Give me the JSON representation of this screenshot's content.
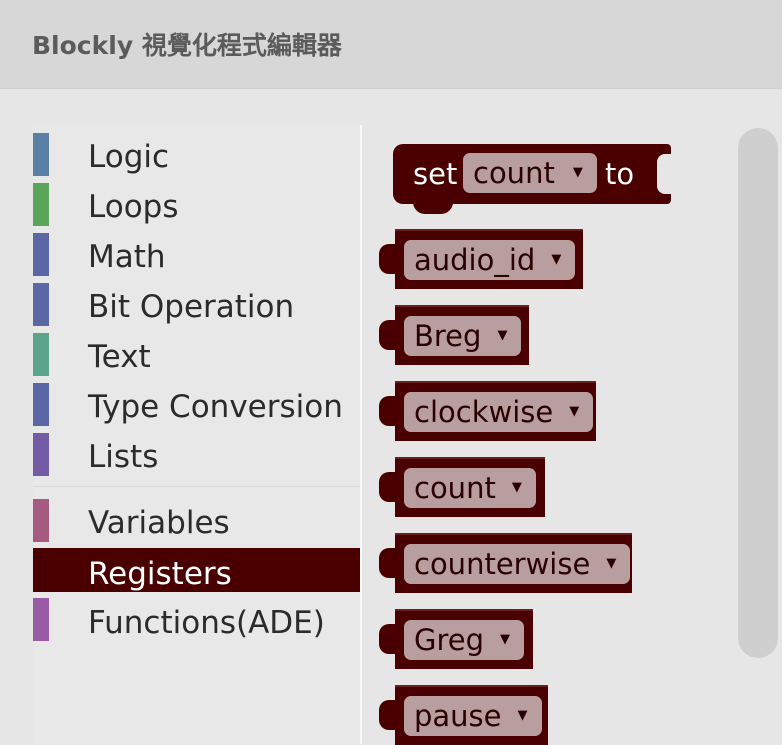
{
  "header": {
    "title": "Blockly 視覺化程式編輯器"
  },
  "toolbox": {
    "categories": [
      {
        "label": "Logic",
        "color": "#5b80a5"
      },
      {
        "label": "Loops",
        "color": "#5ba55b"
      },
      {
        "label": "Math",
        "color": "#5b67a5"
      },
      {
        "label": "Bit Operation",
        "color": "#5b67a5"
      },
      {
        "label": "Text",
        "color": "#5ba58c"
      },
      {
        "label": "Type Conversion",
        "color": "#5b67a5"
      },
      {
        "label": "Lists",
        "color": "#745ba5"
      },
      {
        "label": "Variables",
        "color": "#a55b80"
      },
      {
        "label": "Registers",
        "color": "#4a0000",
        "selected": true
      },
      {
        "label": "Functions(ADE)",
        "color": "#995ba5"
      }
    ]
  },
  "flyout": {
    "set_block": {
      "set_label": "set",
      "var": "count",
      "to_label": "to"
    },
    "getters": [
      "audio_id",
      "Breg",
      "clockwise",
      "count",
      "counterwise",
      "Greg",
      "pause"
    ],
    "dropdown_arrow": "▼",
    "block_color": "#4a0000"
  }
}
